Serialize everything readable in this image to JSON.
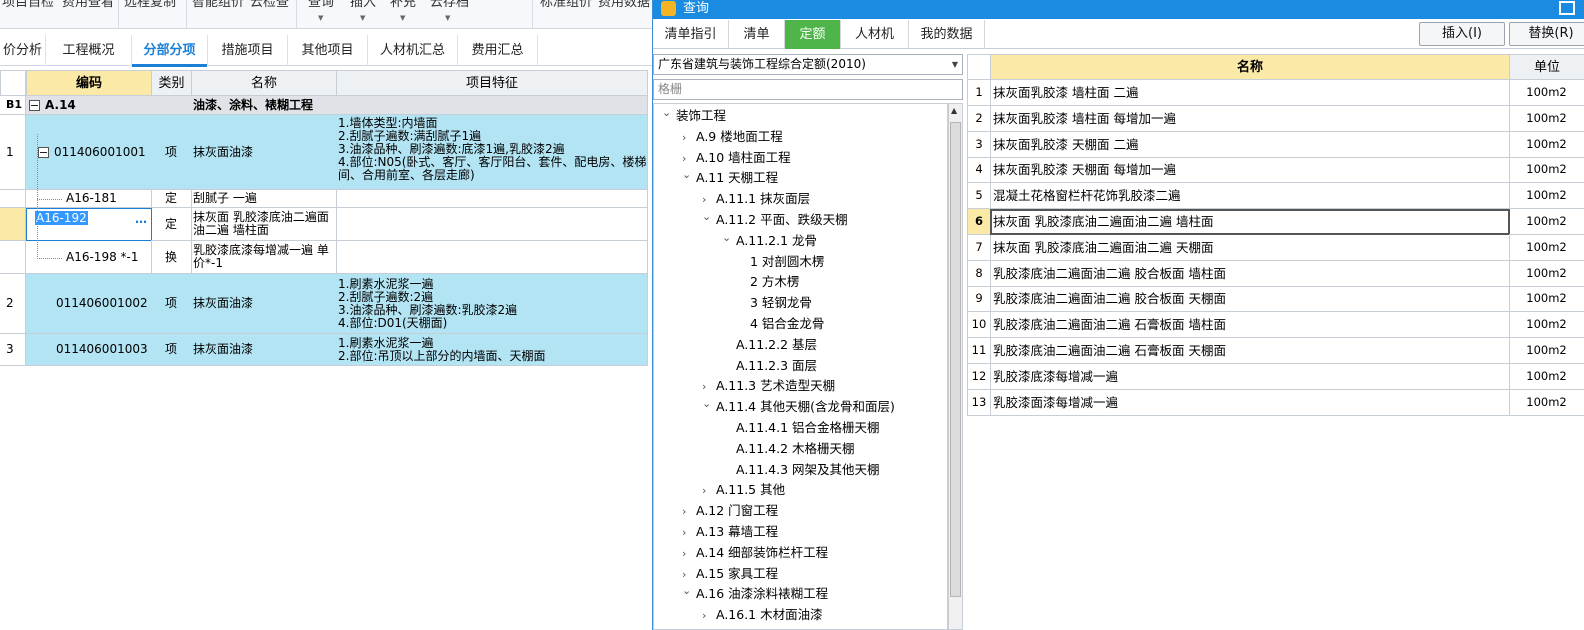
{
  "ribbon": {
    "items": [
      "项目自检",
      "费用查看",
      "远程复制",
      "智能组价",
      "云检查",
      "查询",
      "插入",
      "补充",
      "云存档",
      "标准组价",
      "费用数据"
    ]
  },
  "tabs": [
    "价分析",
    "工程概况",
    "分部分项",
    "措施项目",
    "其他项目",
    "人材机汇总",
    "费用汇总"
  ],
  "grid": {
    "headers": [
      "编码",
      "类别",
      "名称",
      "项目特征"
    ],
    "section": {
      "gutter": "B1",
      "code": "A.14",
      "name": "油漆、涂料、裱糊工程"
    },
    "rows": [
      {
        "num": "1",
        "code": "011406001001",
        "type": "项",
        "name": "抹灰面油漆",
        "features": "1.墙体类型:内墙面\n2.刮腻子遍数:满刮腻子1遍\n3.油漆品种、刷漆遍数:底漆1遍,乳胶漆2遍\n4.部位:N05(卧式、客厅、客厅阳台、套件、配电房、楼梯间、合用前室、各层走廊)"
      },
      {
        "num": "",
        "code": "A16-181",
        "type": "定",
        "name": "刮腻子 一遍",
        "features": ""
      },
      {
        "num": "",
        "code": "A16-192",
        "type": "定",
        "name": "抹灰面 乳胶漆底油二遍面油二遍 墙柱面",
        "features": "",
        "ellipsis": "…"
      },
      {
        "num": "",
        "code": "A16-198 *-1",
        "type": "换",
        "name": "乳胶漆底漆每增减一遍 单价*-1",
        "features": ""
      },
      {
        "num": "2",
        "code": "011406001002",
        "type": "项",
        "name": "抹灰面油漆",
        "features": "1.刷素水泥浆一遍\n2.刮腻子遍数:2遍\n3.油漆品种、刷漆遍数:乳胶漆2遍\n4.部位:D01(天棚面)"
      },
      {
        "num": "3",
        "code": "011406001003",
        "type": "项",
        "name": "抹灰面油漆",
        "features": "1.刷素水泥浆一遍\n2.部位:吊顶以上部分的内墙面、天棚面"
      }
    ]
  },
  "dialog": {
    "title": "查询",
    "tabs": [
      "清单指引",
      "清单",
      "定额",
      "人材机",
      "我的数据"
    ],
    "buttons": {
      "insert": "插入(I)",
      "replace": "替换(R)"
    },
    "combo": "广东省建筑与装饰工程综合定额(2010)",
    "search_placeholder": "格栅",
    "tree": [
      {
        "t": "装饰工程",
        "lvl": 0,
        "ch": "down"
      },
      {
        "t": "A.9 楼地面工程",
        "lvl": 1,
        "ch": "right"
      },
      {
        "t": "A.10 墙柱面工程",
        "lvl": 1,
        "ch": "right"
      },
      {
        "t": "A.11 天棚工程",
        "lvl": 1,
        "ch": "down"
      },
      {
        "t": "A.11.1 抹灰面层",
        "lvl": 2,
        "ch": "right"
      },
      {
        "t": "A.11.2 平面、跌级天棚",
        "lvl": 2,
        "ch": "down"
      },
      {
        "t": "A.11.2.1 龙骨",
        "lvl": 3,
        "ch": "down"
      },
      {
        "t": "1 对剖圆木楞",
        "lvl": 4,
        "ch": ""
      },
      {
        "t": "2 方木楞",
        "lvl": 4,
        "ch": ""
      },
      {
        "t": "3 轻钢龙骨",
        "lvl": 4,
        "ch": ""
      },
      {
        "t": "4 铝合金龙骨",
        "lvl": 4,
        "ch": ""
      },
      {
        "t": "A.11.2.2 基层",
        "lvl": 3,
        "ch": ""
      },
      {
        "t": "A.11.2.3 面层",
        "lvl": 3,
        "ch": ""
      },
      {
        "t": "A.11.3 艺术造型天棚",
        "lvl": 2,
        "ch": "right"
      },
      {
        "t": "A.11.4 其他天棚(含龙骨和面层)",
        "lvl": 2,
        "ch": "down"
      },
      {
        "t": "A.11.4.1 铝合金格栅天棚",
        "lvl": 3,
        "ch": ""
      },
      {
        "t": "A.11.4.2 木格栅天棚",
        "lvl": 3,
        "ch": ""
      },
      {
        "t": "A.11.4.3 网架及其他天棚",
        "lvl": 3,
        "ch": ""
      },
      {
        "t": "A.11.5 其他",
        "lvl": 2,
        "ch": "right"
      },
      {
        "t": "A.12 门窗工程",
        "lvl": 1,
        "ch": "right"
      },
      {
        "t": "A.13 幕墙工程",
        "lvl": 1,
        "ch": "right"
      },
      {
        "t": "A.14 细部装饰栏杆工程",
        "lvl": 1,
        "ch": "right"
      },
      {
        "t": "A.15 家具工程",
        "lvl": 1,
        "ch": "right"
      },
      {
        "t": "A.16 油漆涂料裱糊工程",
        "lvl": 1,
        "ch": "down"
      },
      {
        "t": "A.16.1 木材面油漆",
        "lvl": 2,
        "ch": "right"
      }
    ],
    "table": {
      "headers": [
        "名称",
        "单位"
      ],
      "rows": [
        {
          "n": "1",
          "name": "抹灰面乳胶漆 墙柱面 二遍",
          "unit": "100m2"
        },
        {
          "n": "2",
          "name": "抹灰面乳胶漆 墙柱面 每增加一遍",
          "unit": "100m2"
        },
        {
          "n": "3",
          "name": "抹灰面乳胶漆 天棚面 二遍",
          "unit": "100m2"
        },
        {
          "n": "4",
          "name": "抹灰面乳胶漆 天棚面 每增加一遍",
          "unit": "100m2"
        },
        {
          "n": "5",
          "name": "混凝土花格窗栏杆花饰乳胶漆二遍",
          "unit": "100m2"
        },
        {
          "n": "6",
          "name": "抹灰面 乳胶漆底油二遍面油二遍 墙柱面",
          "unit": "100m2"
        },
        {
          "n": "7",
          "name": "抹灰面 乳胶漆底油二遍面油二遍 天棚面",
          "unit": "100m2"
        },
        {
          "n": "8",
          "name": "乳胶漆底油二遍面油二遍 胶合板面 墙柱面",
          "unit": "100m2"
        },
        {
          "n": "9",
          "name": "乳胶漆底油二遍面油二遍 胶合板面 天棚面",
          "unit": "100m2"
        },
        {
          "n": "10",
          "name": "乳胶漆底油二遍面油二遍 石膏板面 墙柱面",
          "unit": "100m2"
        },
        {
          "n": "11",
          "name": "乳胶漆底油二遍面油二遍 石膏板面 天棚面",
          "unit": "100m2"
        },
        {
          "n": "12",
          "name": "乳胶漆底漆每增减一遍",
          "unit": "100m2"
        },
        {
          "n": "13",
          "name": "乳胶漆面漆每增减一遍",
          "unit": "100m2"
        }
      ]
    }
  }
}
